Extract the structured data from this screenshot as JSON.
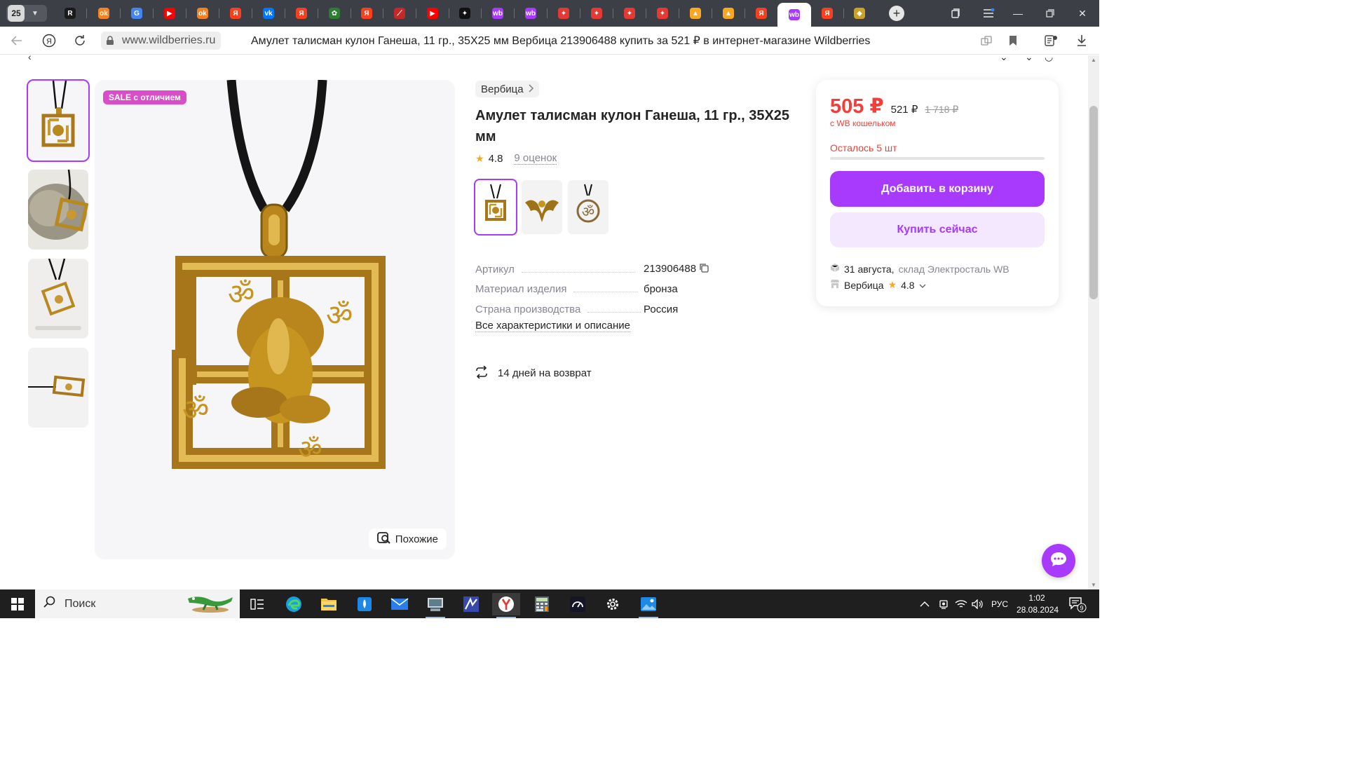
{
  "browser": {
    "tab_count": "25",
    "tabs": [
      {
        "icon": "R",
        "color": "#1a1a1a",
        "name": "rutube"
      },
      {
        "icon": "ok",
        "color": "#f58220",
        "name": "odnoklassniki"
      },
      {
        "icon": "G",
        "color": "#4285f4",
        "name": "google"
      },
      {
        "icon": "▶",
        "color": "#ff0000",
        "name": "youtube"
      },
      {
        "icon": "ok",
        "color": "#f58220",
        "name": "odnoklassniki"
      },
      {
        "icon": "Я",
        "color": "#fc3f1d",
        "name": "yandex"
      },
      {
        "icon": "vk",
        "color": "#0077ff",
        "name": "vk"
      },
      {
        "icon": "Я",
        "color": "#fc3f1d",
        "name": "yandex"
      },
      {
        "icon": "✿",
        "color": "#2e7d32",
        "name": "leaf"
      },
      {
        "icon": "Я",
        "color": "#fc3f1d",
        "name": "yandex"
      },
      {
        "icon": "⟋",
        "color": "#c62828",
        "name": "chart"
      },
      {
        "icon": "▶",
        "color": "#ff0000",
        "name": "youtube"
      },
      {
        "icon": "✦",
        "color": "#111111",
        "name": "star"
      },
      {
        "icon": "wb",
        "color": "#a73afd",
        "name": "wildberries"
      },
      {
        "icon": "wb",
        "color": "#a73afd",
        "name": "wildberries"
      },
      {
        "icon": "✦",
        "color": "#e53935",
        "name": "mail"
      },
      {
        "icon": "✦",
        "color": "#e53935",
        "name": "mail"
      },
      {
        "icon": "✦",
        "color": "#e53935",
        "name": "mail"
      },
      {
        "icon": "✦",
        "color": "#e53935",
        "name": "mail"
      },
      {
        "icon": "▲",
        "color": "#f9a825",
        "name": "images"
      },
      {
        "icon": "▲",
        "color": "#f9a825",
        "name": "images"
      },
      {
        "icon": "Я",
        "color": "#fc3f1d",
        "name": "yandex"
      },
      {
        "icon": "wb",
        "color": "#a73afd",
        "name": "wildberries",
        "active": true
      },
      {
        "icon": "Я",
        "color": "#fc3f1d",
        "name": "yandex"
      },
      {
        "icon": "◆",
        "color": "#c9a227",
        "name": "shield"
      }
    ],
    "url_domain": "www.wildberries.ru",
    "page_title": "Амулет талисман кулон Ганеша, 11 гр., 35Х25 мм Вербица 213906488 купить за 521 ₽ в интернет-магазине Wildberries"
  },
  "product": {
    "sale_badge": "SALE с отличием",
    "similar_label": "Похожие",
    "brand": "Вербица",
    "title": "Амулет талисман кулон Ганеша, 11 гр., 35Х25 мм",
    "rating": "4.8",
    "reviews": "9 оценок",
    "specs": [
      {
        "key": "Артикул",
        "value": "213906488"
      },
      {
        "key": "Материал изделия",
        "value": "бронза"
      },
      {
        "key": "Страна производства",
        "value": "Россия"
      }
    ],
    "all_specs_link": "Все характеристики и описание",
    "returns": "14 дней на возврат"
  },
  "buybox": {
    "price": "505 ₽",
    "price_regular": "521 ₽",
    "price_old": "1 718 ₽",
    "wallet_note": "с WB кошельком",
    "stock": "Осталось 5 шт",
    "add_to_cart": "Добавить в корзину",
    "buy_now": "Купить сейчас",
    "delivery_date": "31 августа,",
    "warehouse": "склад Электросталь WB",
    "seller": "Вербица",
    "seller_rating": "4.8"
  },
  "taskbar": {
    "search_placeholder": "Поиск",
    "language": "РУС",
    "time": "1:02",
    "date": "28.08.2024",
    "notifications": "9"
  },
  "colors": {
    "accent": "#a73afd",
    "price_red": "#f0403b",
    "star": "#f9a823"
  }
}
